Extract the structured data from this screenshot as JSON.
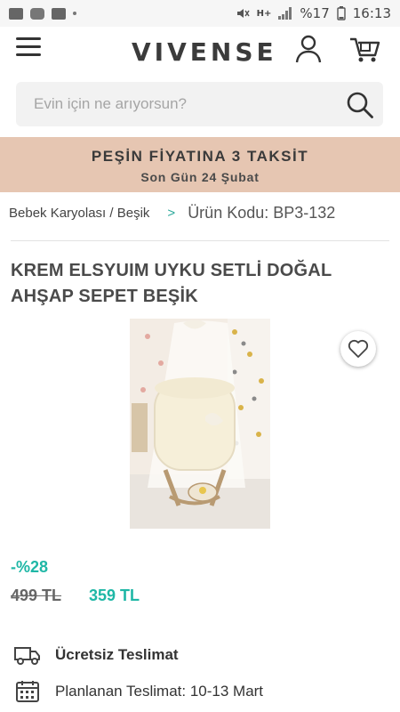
{
  "status_bar": {
    "battery": "%17",
    "time": "16:13",
    "network": "H+"
  },
  "header": {
    "logo": "VIVENSE",
    "icons": [
      "menu-icon",
      "user-icon",
      "cart-icon"
    ]
  },
  "search": {
    "placeholder": "Evin için ne arıyorsun?"
  },
  "promo": {
    "title": "PEŞİN FİYATINA 3 TAKSİT",
    "subtitle": "Son Gün 24 Şubat",
    "background": "#e6c6b2"
  },
  "breadcrumb": {
    "category": "Bebek Karyolası / Beşik",
    "separator": ">",
    "product_code": "Ürün Kodu: BP3-132"
  },
  "product": {
    "title": "KREM ELSYUIM UYKU SETLİ DOĞAL AHŞAP SEPET BEŞİK",
    "discount": "-%28",
    "old_price": "499 TL",
    "new_price": "359 TL",
    "accent_color": "#1fb7a6"
  },
  "delivery": {
    "free_shipping": "Ücretsiz Teslimat",
    "planned": "Planlanan Teslimat: 10-13 Mart"
  }
}
